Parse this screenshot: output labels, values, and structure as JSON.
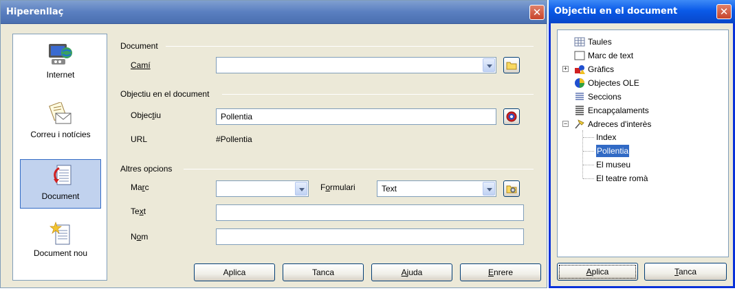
{
  "hyperlink_dialog": {
    "title": "Hiperenllaç",
    "close_glyph": "✕",
    "sidebar": [
      {
        "label": "Internet",
        "icon": "globe-computer-icon"
      },
      {
        "label": "Correu i notícies",
        "icon": "mail-envelope-icon"
      },
      {
        "label": "Document",
        "icon": "document-link-icon",
        "selected": true
      },
      {
        "label": "Document nou",
        "icon": "new-document-icon"
      }
    ],
    "document_group": {
      "label": "Document",
      "path_label": "Camí",
      "path_value": ""
    },
    "target_group": {
      "label": "Objectiu en el document",
      "target_label": "Objectiu",
      "target_value": "Pollentia",
      "url_label": "URL",
      "url_value": "#Pollentia"
    },
    "other_group": {
      "label": "Altres opcions",
      "frame_label": "Marc",
      "frame_value": "",
      "form_label": "Formulari",
      "form_value": "Text",
      "text_label": "Text",
      "text_value": "",
      "name_label": "Nom",
      "name_value": ""
    },
    "buttons": {
      "apply": "Aplica",
      "close": "Tanca",
      "help": "Ajuda",
      "back": "Enrere"
    }
  },
  "navigator_dialog": {
    "title": "Objectiu en el document",
    "close_glyph": "✕",
    "tree": [
      {
        "label": "Taules",
        "icon": "table-icon"
      },
      {
        "label": "Marc de text",
        "icon": "text-frame-icon"
      },
      {
        "label": "Gràfics",
        "icon": "graphics-icon",
        "expandable": "+"
      },
      {
        "label": "Objectes OLE",
        "icon": "ole-object-icon"
      },
      {
        "label": "Seccions",
        "icon": "sections-icon"
      },
      {
        "label": "Encapçalaments",
        "icon": "headings-icon"
      },
      {
        "label": "Adreces d'interès",
        "icon": "bookmark-pin-icon",
        "expandable": "−",
        "children": [
          {
            "label": "Index"
          },
          {
            "label": "Pollentia",
            "selected": true
          },
          {
            "label": "El museu"
          },
          {
            "label": "El teatre romà"
          }
        ]
      }
    ],
    "buttons": {
      "apply": "Aplica",
      "close": "Tanca"
    }
  }
}
